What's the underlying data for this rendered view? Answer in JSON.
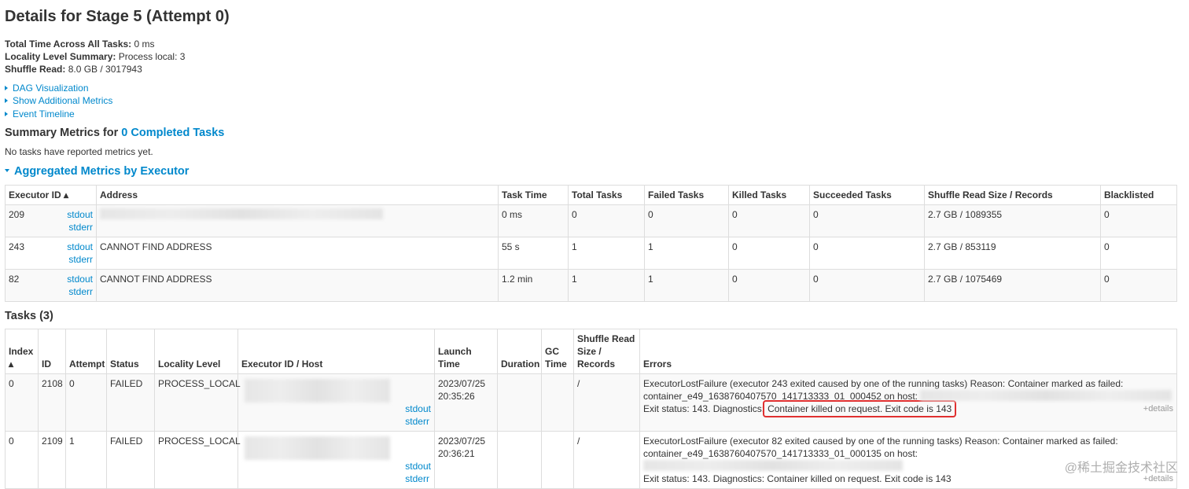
{
  "title": "Details for Stage 5 (Attempt 0)",
  "info": [
    {
      "label": "Total Time Across All Tasks:",
      "value": "0 ms"
    },
    {
      "label": "Locality Level Summary:",
      "value": "Process local: 3"
    },
    {
      "label": "Shuffle Read:",
      "value": "8.0 GB / 3017943"
    }
  ],
  "toggles": [
    "DAG Visualization",
    "Show Additional Metrics",
    "Event Timeline"
  ],
  "summary": {
    "prefix": "Summary Metrics for ",
    "link": "0 Completed Tasks",
    "note": "No tasks have reported metrics yet."
  },
  "aggregated": {
    "title": "Aggregated Metrics by Executor",
    "headers": [
      "Executor ID ▴",
      "Address",
      "Task Time",
      "Total Tasks",
      "Failed Tasks",
      "Killed Tasks",
      "Succeeded Tasks",
      "Shuffle Read Size / Records",
      "Blacklisted"
    ],
    "rows": [
      {
        "id": "209",
        "stdout": "stdout",
        "stderr": "stderr",
        "address": "",
        "task_time": "0 ms",
        "total": "0",
        "failed": "0",
        "killed": "0",
        "succeeded": "0",
        "shuffle": "2.7 GB / 1089355",
        "blacklisted": "0"
      },
      {
        "id": "243",
        "stdout": "stdout",
        "stderr": "stderr",
        "address": "CANNOT FIND ADDRESS",
        "task_time": "55 s",
        "total": "1",
        "failed": "1",
        "killed": "0",
        "succeeded": "0",
        "shuffle": "2.7 GB / 853119",
        "blacklisted": "0"
      },
      {
        "id": "82",
        "stdout": "stdout",
        "stderr": "stderr",
        "address": "CANNOT FIND ADDRESS",
        "task_time": "1.2 min",
        "total": "1",
        "failed": "1",
        "killed": "0",
        "succeeded": "0",
        "shuffle": "2.7 GB / 1075469",
        "blacklisted": "0"
      }
    ]
  },
  "tasks": {
    "title": "Tasks (3)",
    "headers": [
      "Index ▴",
      "ID",
      "Attempt",
      "Status",
      "Locality Level",
      "Executor ID / Host",
      "Launch Time",
      "Duration",
      "GC Time",
      "Shuffle Read Size / Records",
      "Errors"
    ],
    "rows": [
      {
        "index": "0",
        "id": "2108",
        "attempt": "0",
        "status": "FAILED",
        "locality": "PROCESS_LOCAL",
        "stdout": "stdout",
        "stderr": "stderr",
        "launch": "2023/07/25 20:35:26",
        "duration": "",
        "gc": "",
        "shuffle": "/",
        "err1": "ExecutorLostFailure (executor 243 exited caused by one of the running tasks) Reason: Container marked as failed:",
        "err2": "container_e49_1638760407570_141713333_01_000452 on host:",
        "err3a": "Exit status: 143. Diagnostics:",
        "err3b": "Container killed on request. Exit code is 143",
        "details": "+details"
      },
      {
        "index": "0",
        "id": "2109",
        "attempt": "1",
        "status": "FAILED",
        "locality": "PROCESS_LOCAL",
        "stdout": "stdout",
        "stderr": "stderr",
        "launch": "2023/07/25 20:36:21",
        "duration": "",
        "gc": "",
        "shuffle": "/",
        "err1": "ExecutorLostFailure (executor 82 exited caused by one of the running tasks) Reason: Container marked as failed:",
        "err2": "container_e49_1638760407570_141713333_01_000135 on host:",
        "err3a": "Exit status: 143. Diagnostics:",
        "err3b": "Container killed on request. Exit code is 143",
        "details": "+details"
      }
    ]
  },
  "highlight_color": "#e03030",
  "link_color": "#0088cc",
  "watermark": "@稀土掘金技术社区"
}
